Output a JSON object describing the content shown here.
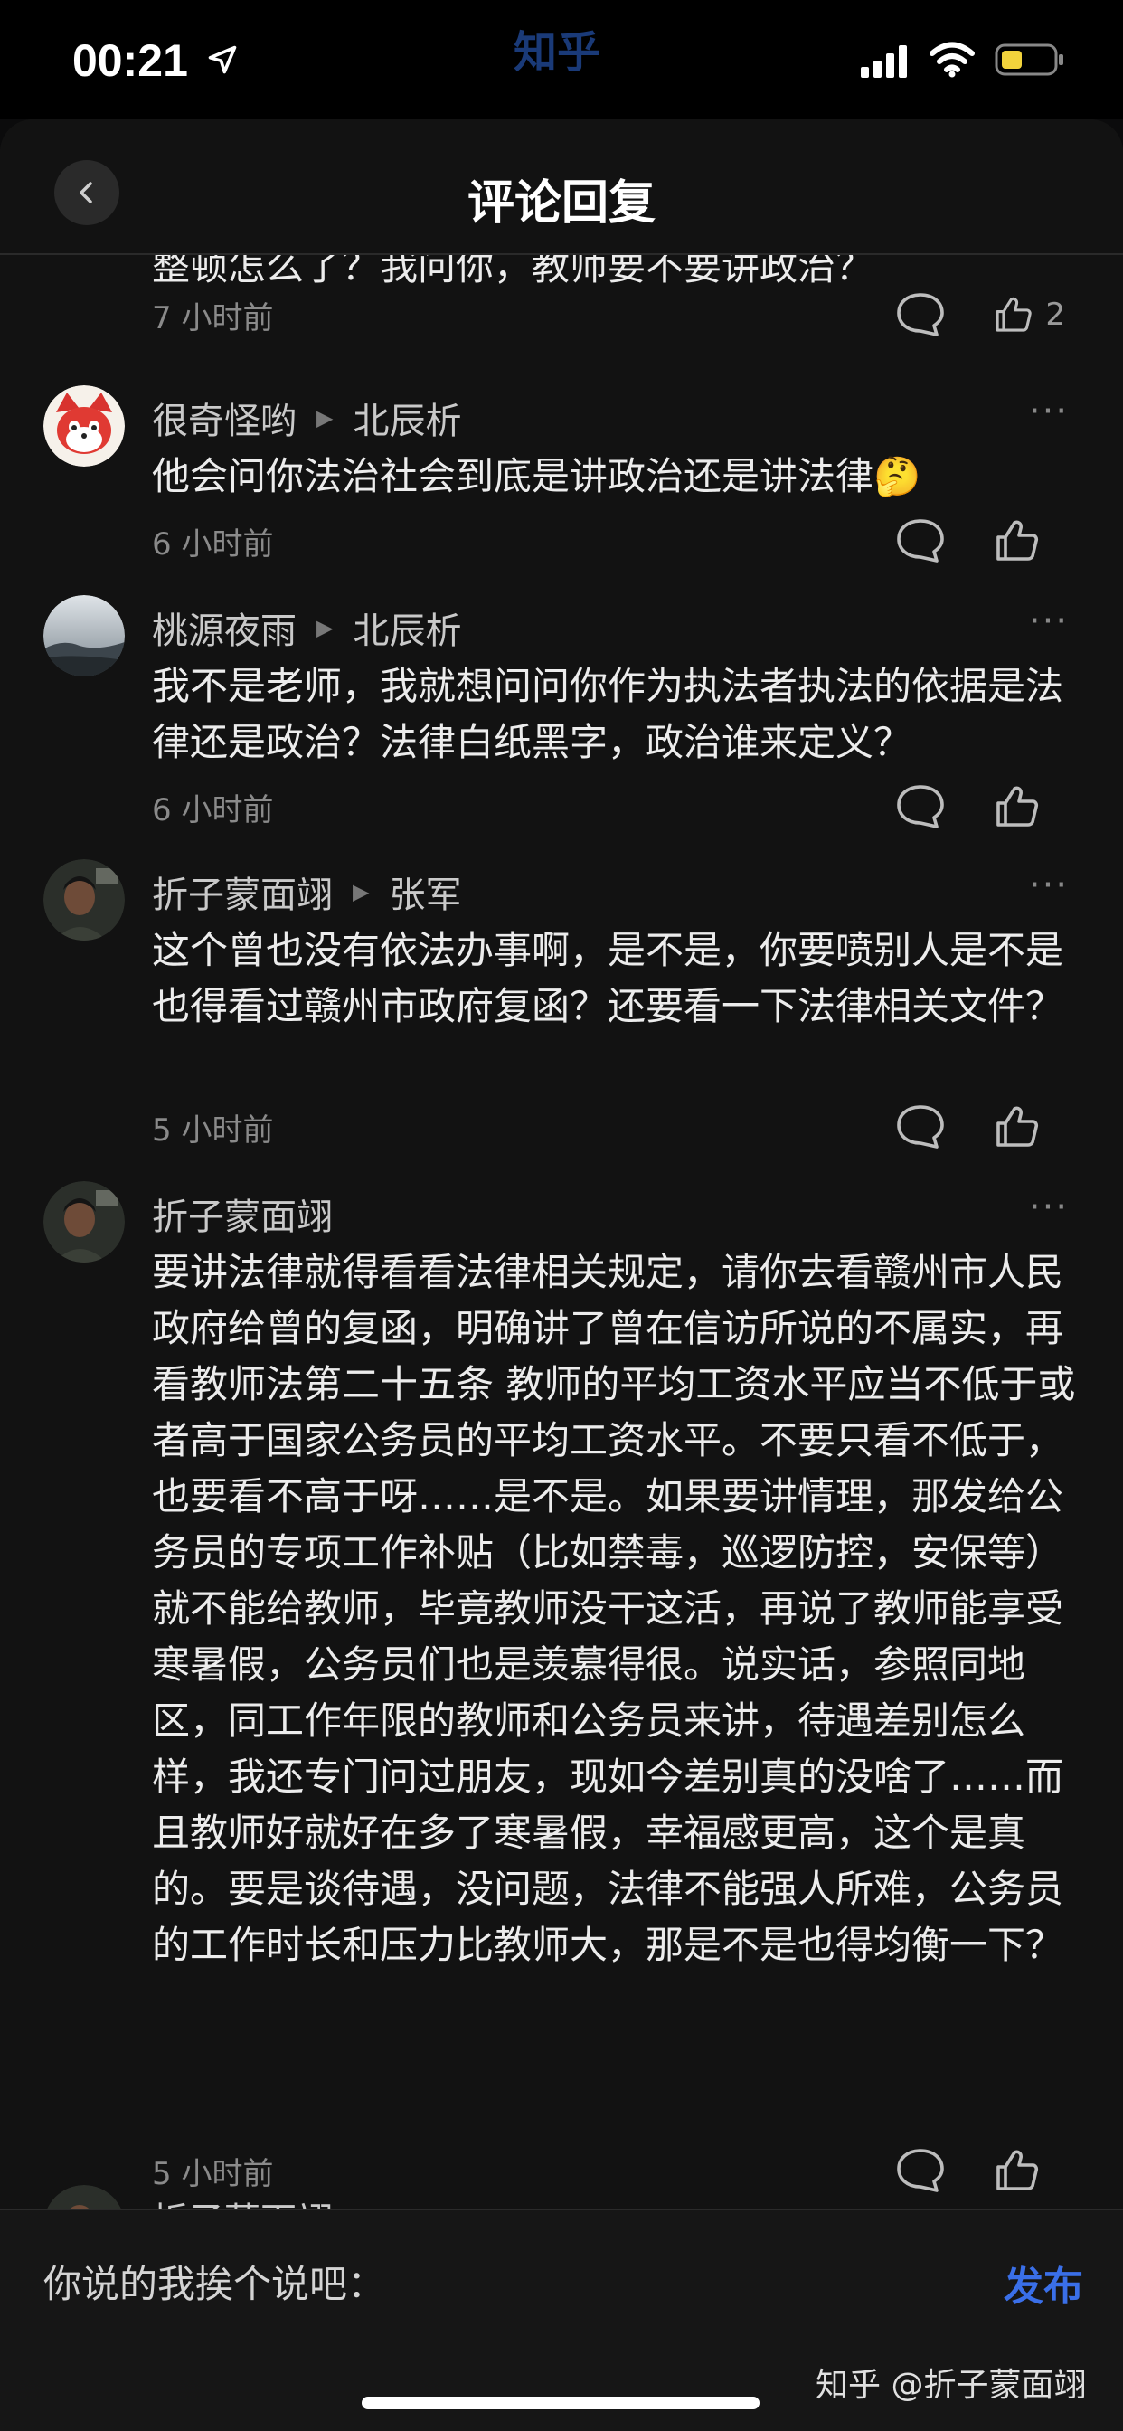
{
  "status_bar": {
    "time": "00:21",
    "app_name": "知乎"
  },
  "header": {
    "title": "评论回复"
  },
  "comments": [
    {
      "body": "整顿怎么了？我问你，教师要不要讲政治？",
      "time": "7 小时前",
      "likes": "2"
    },
    {
      "author": "很奇怪哟",
      "reply_to": "北辰析",
      "body": "他会问你法治社会到底是讲政治还是讲法律🤔",
      "time": "6 小时前"
    },
    {
      "author": "桃源夜雨",
      "reply_to": "北辰析",
      "body": "我不是老师，我就想问问你作为执法者执法的依据是法律还是政治？法律白纸黑字，政治谁来定义？",
      "time": "6 小时前"
    },
    {
      "author": "折子蒙面翊",
      "reply_to": "张军",
      "body": "这个曾也没有依法办事啊，是不是，你要喷别人是不是也得看过赣州市政府复函？还要看一下法律相关文件？",
      "time": "5 小时前"
    },
    {
      "author": "折子蒙面翊",
      "body": "要讲法律就得看看法律相关规定，请你去看赣州市人民政府给曾的复函，明确讲了曾在信访所说的不属实，再看教师法第二十五条 教师的平均工资水平应当不低于或者高于国家公务员的平均工资水平。不要只看不低于，也要看不高于呀……是不是。如果要讲情理，那发给公务员的专项工作补贴（比如禁毒，巡逻防控，安保等）就不能给教师，毕竟教师没干这活，再说了教师能享受寒暑假，公务员们也是羡慕得很。说实话，参照同地区，同工作年限的教师和公务员来讲，待遇差别怎么样，我还专门问过朋友，现如今差别真的没啥了……而且教师好就好在多了寒暑假，幸福感更高，这个是真的。要是谈待遇，没问题，法律不能强人所难，公务员的工作时长和压力比教师大，那是不是也得均衡一下？",
      "time": "5 小时前"
    },
    {
      "author": "折子蒙面翊"
    }
  ],
  "input_bar": {
    "placeholder": "你说的我挨个说吧：",
    "publish_label": "发布"
  },
  "watermark": "知乎 @折子蒙面翊",
  "colors": {
    "background": "#121212",
    "accent": "#3a6fe8",
    "time_text": "#8a8a8a"
  },
  "icons": [
    "back-chevron-icon",
    "reply-bubble-icon",
    "thumbs-up-icon",
    "more-dots-icon"
  ]
}
